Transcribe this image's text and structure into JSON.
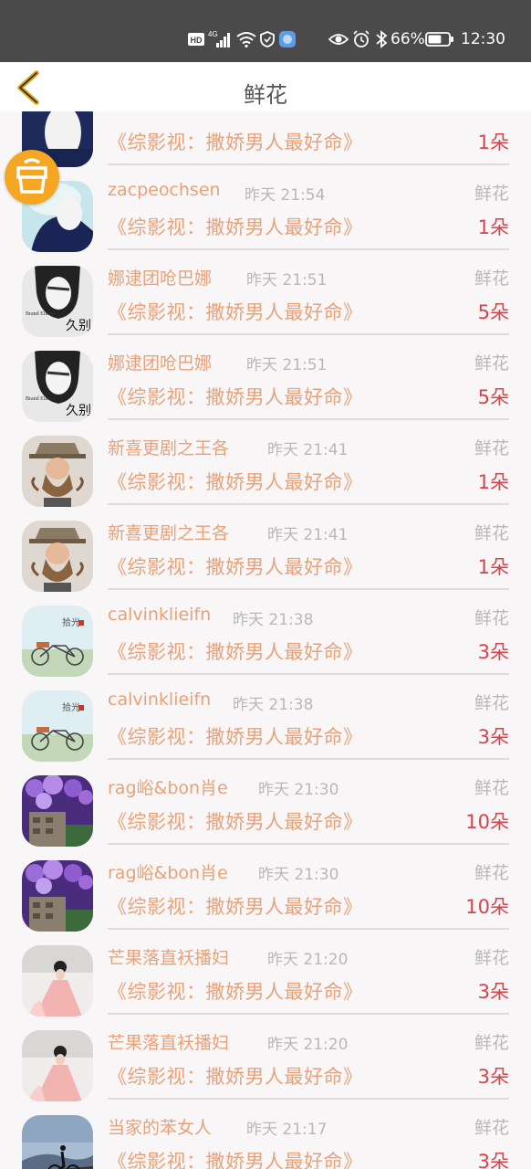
{
  "status_bar": {
    "icons": [
      "hd-icon",
      "signal-4g-icon",
      "wifi-icon",
      "shield-icon",
      "app-icon",
      "eye-icon",
      "bluetooth-icon",
      "alarm-icon"
    ],
    "battery": "66%",
    "battery_level": 0.66,
    "time": "12:30"
  },
  "header": {
    "title": "鲜花"
  },
  "rows": [
    {
      "name": "",
      "time": "",
      "type": "",
      "show": "《综影视：撒娇男人最好命》",
      "count": "1朵"
    },
    {
      "name": "zacpeochsen",
      "time": "昨天 21:54",
      "type": "鲜花",
      "show": "《综影视：撒娇男人最好命》",
      "count": "1朵"
    },
    {
      "name": "娜逮团呛巴娜",
      "time": "昨天 21:51",
      "type": "鲜花",
      "show": "《综影视：撒娇男人最好命》",
      "count": "5朵"
    },
    {
      "name": "娜逮团呛巴娜",
      "time": "昨天 21:51",
      "type": "鲜花",
      "show": "《综影视：撒娇男人最好命》",
      "count": "5朵"
    },
    {
      "name": "新喜更剧之王各",
      "time": "昨天 21:41",
      "type": "鲜花",
      "show": "《综影视：撒娇男人最好命》",
      "count": "1朵"
    },
    {
      "name": "新喜更剧之王各",
      "time": "昨天 21:41",
      "type": "鲜花",
      "show": "《综影视：撒娇男人最好命》",
      "count": "1朵"
    },
    {
      "name": "calvinklieifn",
      "time": "昨天 21:38",
      "type": "鲜花",
      "show": "《综影视：撒娇男人最好命》",
      "count": "3朵"
    },
    {
      "name": "calvinklieifn",
      "time": "昨天 21:38",
      "type": "鲜花",
      "show": "《综影视：撒娇男人最好命》",
      "count": "3朵"
    },
    {
      "name": "rag峪&bon肖e",
      "time": "昨天 21:30",
      "type": "鲜花",
      "show": "《综影视：撒娇男人最好命》",
      "count": "10朵"
    },
    {
      "name": "rag峪&bon肖e",
      "time": "昨天 21:30",
      "type": "鲜花",
      "show": "《综影视：撒娇男人最好命》",
      "count": "10朵"
    },
    {
      "name": "芒果落直袄播妇",
      "time": "昨天 21:20",
      "type": "鲜花",
      "show": "《综影视：撒娇男人最好命》",
      "count": "3朵"
    },
    {
      "name": "芒果落直袄播妇",
      "time": "昨天 21:20",
      "type": "鲜花",
      "show": "《综影视：撒娇男人最好命》",
      "count": "3朵"
    },
    {
      "name": "当家的苯女人",
      "time": "昨天 21:17",
      "type": "鲜花",
      "show": "《综影视：撒娇男人最好命》",
      "count": "3朵"
    }
  ],
  "avatar_text": {
    "bw_girl": "久别"
  },
  "colors": {
    "accent": "#e8a27a",
    "count": "#d8434a",
    "muted": "#b8b8b8",
    "float_button": "#f5a623",
    "back_arrow": "#d4a017"
  }
}
